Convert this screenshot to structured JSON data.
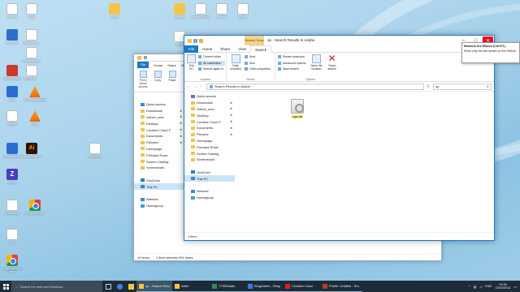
{
  "desktop_icons": [
    {
      "label": "Gilabo X",
      "kind": "c-doc"
    },
    {
      "label": "Stop",
      "kind": "c-doc"
    },
    {
      "label": "Ferris_Ac.",
      "kind": "c-blue"
    },
    {
      "label": "Acrobat Sh..",
      "kind": "c-doc"
    },
    {
      "label": "CombinedSig..",
      "kind": "c-doc"
    },
    {
      "label": "Adobe Reader",
      "kind": "c-red"
    },
    {
      "label": "EPSB 07 ...",
      "kind": "c-doc"
    },
    {
      "label": "Mics",
      "kind": "c-blue"
    },
    {
      "label": "VLC media player",
      "kind": "c-vlc"
    },
    {
      "label": "spawn",
      "kind": "c-doc"
    },
    {
      "label": "VLC",
      "kind": "c-vlc"
    },
    {
      "label": "ApowerMirror",
      "kind": "c-blue"
    },
    {
      "label": "Adobe Illustrator",
      "kind": "c-ai"
    },
    {
      "label": "Zotero",
      "kind": "c-z"
    },
    {
      "label": "ScoreFlow",
      "kind": "c-doc"
    },
    {
      "label": "ApowerEdit",
      "kind": "c-doc"
    },
    {
      "label": "Google Chrome",
      "kind": "c-chrome"
    },
    {
      "label": "Doc",
      "kind": "c-doc"
    },
    {
      "label": "Google Chrome - Copy",
      "kind": "c-chrome"
    }
  ],
  "desktop_icons_top": [
    {
      "label": "Folder",
      "kind": "c-folder"
    },
    {
      "label": "Utilities",
      "kind": "c-folder"
    },
    {
      "label": "Access Report",
      "kind": "c-doc"
    },
    {
      "label": "Ravens",
      "kind": "c-doc"
    },
    {
      "label": "Sheet",
      "kind": "c-doc"
    },
    {
      "label": "Doc2",
      "kind": "c-doc"
    }
  ],
  "back_window": {
    "tabs": [
      "File",
      "Home",
      "Share",
      "View"
    ],
    "ribbon": [
      "Pin to Quick access",
      "Copy",
      "Paste"
    ],
    "nav": [
      {
        "label": "Quick access",
        "pin": false,
        "sel": false
      },
      {
        "label": "Downloads",
        "pin": true,
        "sel": false
      },
      {
        "label": "Gdrive_new",
        "pin": true,
        "sel": false
      },
      {
        "label": "Desktop",
        "pin": true,
        "sel": false
      },
      {
        "label": "Creative Cloud F",
        "pin": true,
        "sel": false
      },
      {
        "label": "Documents",
        "pin": true,
        "sel": false
      },
      {
        "label": "Pictures",
        "pin": true,
        "sel": false
      },
      {
        "label": "Homepage",
        "pin": false,
        "sel": false
      },
      {
        "label": "Principal Rows",
        "pin": false,
        "sel": false
      },
      {
        "label": "Screen Casting",
        "pin": false,
        "sel": false
      },
      {
        "label": "Screenshots",
        "pin": false,
        "sel": false
      },
      {
        "label": "",
        "pin": false,
        "sel": false
      },
      {
        "label": "OneDrive",
        "pin": false,
        "sel": false
      },
      {
        "label": "This PC",
        "pin": false,
        "sel": true
      },
      {
        "label": "",
        "pin": false,
        "sel": false
      },
      {
        "label": "Network",
        "pin": false,
        "sel": false
      },
      {
        "label": "Homegroup",
        "pin": false,
        "sel": false
      }
    ],
    "status_items": "10 items",
    "status_selected": "1 item selected  951 bytes"
  },
  "window": {
    "context_tab": "Search Tools",
    "title": "op - Search Results in Adobe",
    "ribbon_tabs": [
      "File",
      "Home",
      "Share",
      "View",
      "Search"
    ],
    "active_tab": "Search",
    "groups": {
      "location": {
        "label": "Location",
        "big": "This PC",
        "items": [
          "Current folder",
          "All subfolders",
          "Search again in"
        ]
      },
      "refine": {
        "label": "Refine",
        "big": "Date modified",
        "items": [
          "Kind",
          "Size",
          "Other properties"
        ]
      },
      "options": {
        "label": "Options",
        "items": [
          "Recent searches",
          "Advanced options",
          "Save search"
        ],
        "big1": "Open file location",
        "big2": "Close search"
      }
    },
    "address": "Search Results in Adobe",
    "search_value": "op",
    "nav": [
      {
        "label": "Quick access",
        "pin": false,
        "sel": false
      },
      {
        "label": "Downloads",
        "pin": true,
        "sel": false
      },
      {
        "label": "Gdrive_new",
        "pin": true,
        "sel": false
      },
      {
        "label": "Desktop",
        "pin": true,
        "sel": false
      },
      {
        "label": "Creative Cloud F",
        "pin": true,
        "sel": false
      },
      {
        "label": "Documents",
        "pin": true,
        "sel": false
      },
      {
        "label": "Pictures",
        "pin": true,
        "sel": false
      },
      {
        "label": "Homepage",
        "pin": false,
        "sel": false
      },
      {
        "label": "Principal Rows",
        "pin": false,
        "sel": false
      },
      {
        "label": "Screen Casting",
        "pin": false,
        "sel": false
      },
      {
        "label": "Screenshots",
        "pin": false,
        "sel": false
      },
      {
        "label": "",
        "pin": false,
        "sel": false
      },
      {
        "label": "OneDrive",
        "pin": false,
        "sel": false
      },
      {
        "label": "This PC",
        "pin": false,
        "sel": true
      },
      {
        "label": "",
        "pin": false,
        "sel": false
      },
      {
        "label": "Network",
        "pin": false,
        "sel": false
      },
      {
        "label": "Homegroup",
        "pin": false,
        "sel": false
      }
    ],
    "file": {
      "name": "ogm.db"
    },
    "status": "1 item"
  },
  "tooltip": {
    "title": "Minimize the Ribbon (Ctrl+F1)",
    "body": "Show only the tab names on the Ribbon."
  },
  "taskbar": {
    "search_placeholder": "Search the web and Windows",
    "apps": [
      {
        "label": "op - Search Results...",
        "color": "#f3c34a",
        "active": true
      },
      {
        "label": "Ather",
        "color": "#f3c34a",
        "active": false
      },
      {
        "label": "TTSReader",
        "color": "#2e8b57",
        "active": false
      },
      {
        "label": "KingAdmin - Resp...",
        "color": "#3a7bd5",
        "active": false
      },
      {
        "label": "Creative Cloud",
        "color": "#da1f26",
        "active": false
      },
      {
        "label": "Profile: Untitled - Sm...",
        "color": "#c0392b",
        "active": false
      }
    ],
    "lang": "ENG",
    "time": "19:36",
    "date": "13/04/2018"
  }
}
